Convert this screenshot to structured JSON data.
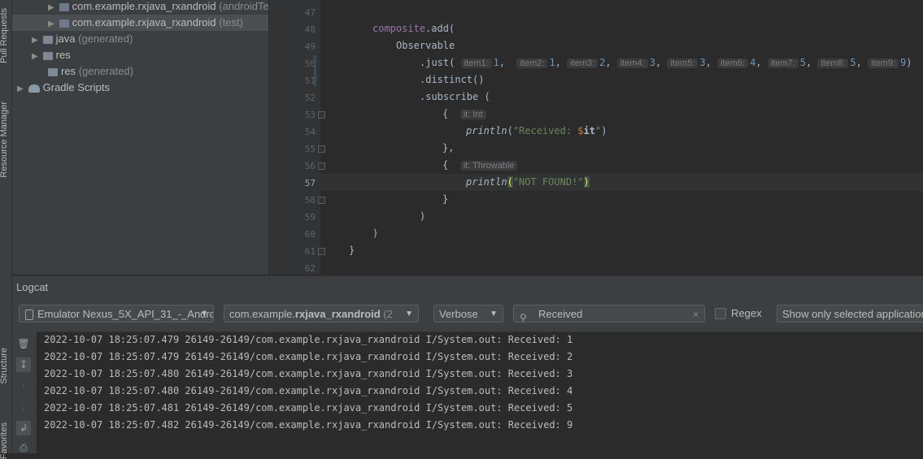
{
  "sidebar_tabs": {
    "pull_requests": "Pull Requests",
    "resource_manager": "Resource Manager",
    "structure": "Structure",
    "favorites": "Favorites"
  },
  "tree": {
    "items": [
      {
        "name": "com.example.rxjava_rxandroid",
        "suffix": "(androidTest)"
      },
      {
        "name": "com.example.rxjava_rxandroid",
        "suffix": "(test)"
      },
      {
        "name": "java",
        "suffix": "(generated)"
      },
      {
        "name": "res",
        "suffix": ""
      },
      {
        "name": "res",
        "suffix": "(generated)"
      },
      {
        "name": "Gradle Scripts",
        "suffix": ""
      }
    ]
  },
  "editor": {
    "line_numbers": [
      "47",
      "48",
      "49",
      "50",
      "51",
      "52",
      "53",
      "54",
      "55",
      "56",
      "57",
      "58",
      "59",
      "60",
      "61",
      "62"
    ],
    "current_line": "57",
    "hints": {
      "it_int": "it: Int",
      "it_throwable": "it: Throwable"
    },
    "received_str": "\"Received: ",
    "not_found_str": "\"NOT FOUND!\""
  },
  "logcat": {
    "title": "Logcat",
    "device": "Emulator Nexus_5X_API_31_-_Andro",
    "process_prefix": "com.example.",
    "process_bold": "rxjava_rxandroid",
    "process_suffix": " (2",
    "level": "Verbose",
    "search_value": "Received",
    "regex_label": "Regex",
    "filter": "Show only selected application",
    "lines": [
      "2022-10-07 18:25:07.479 26149-26149/com.example.rxjava_rxandroid I/System.out: Received: 1",
      "2022-10-07 18:25:07.479 26149-26149/com.example.rxjava_rxandroid I/System.out: Received: 2",
      "2022-10-07 18:25:07.480 26149-26149/com.example.rxjava_rxandroid I/System.out: Received: 3",
      "2022-10-07 18:25:07.480 26149-26149/com.example.rxjava_rxandroid I/System.out: Received: 4",
      "2022-10-07 18:25:07.481 26149-26149/com.example.rxjava_rxandroid I/System.out: Received: 5",
      "2022-10-07 18:25:07.482 26149-26149/com.example.rxjava_rxandroid I/System.out: Received: 9"
    ]
  }
}
